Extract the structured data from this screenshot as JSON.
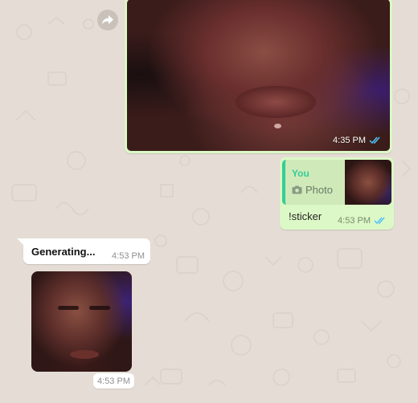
{
  "messages": {
    "photo": {
      "time": "4:35 PM",
      "status_icon": "double-check-blue"
    },
    "reply": {
      "quote_author": "You",
      "quote_type": "Photo",
      "text": "!sticker",
      "time": "4:53 PM",
      "status_icon": "double-check-blue"
    },
    "incoming": {
      "text": "Generating...",
      "time": "4:53 PM"
    },
    "sticker": {
      "time": "4:53 PM"
    }
  },
  "icons": {
    "forward": "forward-arrow-icon",
    "camera": "camera-icon",
    "read_receipt": "double-check-icon"
  },
  "colors": {
    "outgoing_bubble": "#dcf8c6",
    "incoming_bubble": "#ffffff",
    "read_tick": "#4fc3f7",
    "quote_accent": "#35cd96",
    "background": "#e5ddd5"
  }
}
